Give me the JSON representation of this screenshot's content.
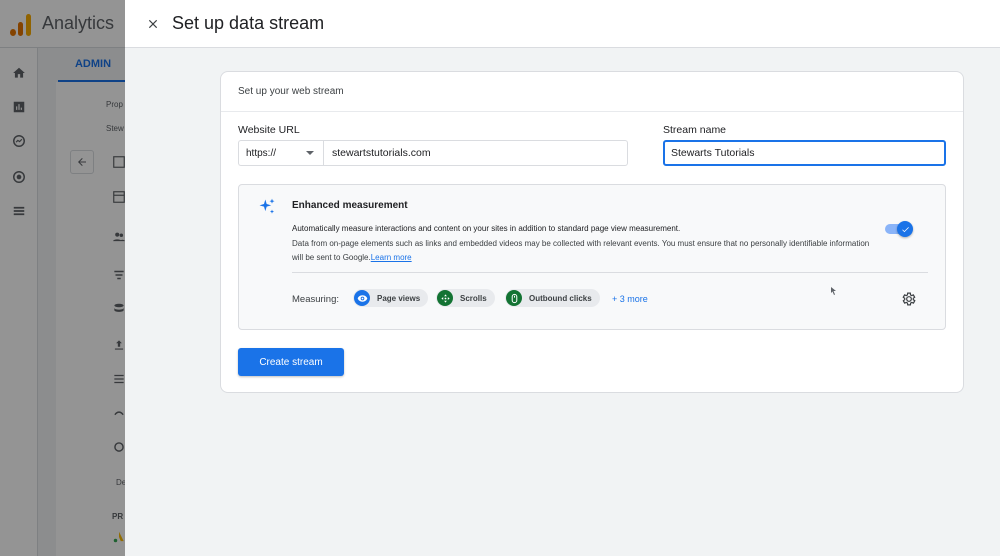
{
  "background": {
    "app_title": "Analytics",
    "admin_tab": "ADMIN",
    "property_label": "Prop",
    "account_label": "Stew",
    "section_label": "De",
    "section_label_2": "PR"
  },
  "dialog": {
    "title": "Set up data stream",
    "card_title": "Set up your web stream",
    "website_url_label": "Website URL",
    "protocol_value": "https://",
    "website_url_value": "stewartstutorials.com",
    "stream_name_label": "Stream name",
    "stream_name_value": "Stewarts Tutorials",
    "enhanced": {
      "title": "Enhanced measurement",
      "desc_line1": "Automatically measure interactions and content on your sites in addition to standard page view measurement.",
      "desc_line2": "Data from on-page elements such as links and embedded videos may be collected with relevant events. You must ensure that no personally identifiable information will be sent to Google.",
      "learn_more": "Learn more",
      "toggle_on": true,
      "measuring_label": "Measuring:",
      "chips": [
        "Page views",
        "Scrolls",
        "Outbound clicks"
      ],
      "more": "+ 3 more"
    },
    "create_button": "Create stream"
  },
  "colors": {
    "accent": "#1a73e8",
    "chip_blue": "#1a73e8",
    "chip_green": "#137333",
    "toggle_track": "#8ab4f8"
  }
}
